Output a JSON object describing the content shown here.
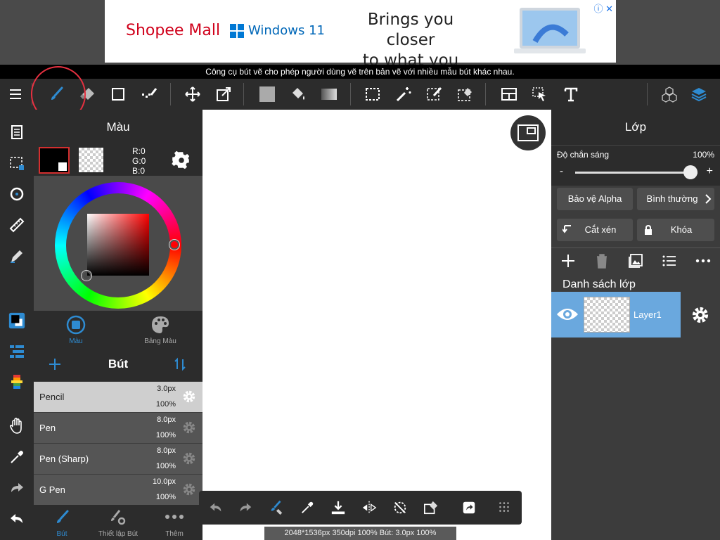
{
  "ad": {
    "brand": "Shopee Mall",
    "product": "Windows 11",
    "tagline_1": "Brings you closer",
    "tagline_2": "to what you love.",
    "close_glyph": "ⓘ ✕"
  },
  "tooltip": "Công cụ bút vẽ cho phép người dùng vẽ trên bản vẽ với nhiều mẫu bút khác nhau.",
  "colors": {
    "accent": "#2e8bd1",
    "selected_layer": "#6aa8de",
    "highlight": "#e53040",
    "panel_dark": "#2c2c2c",
    "panel_mid": "#3c3c3c"
  },
  "toolbar": {
    "menu_icon": "hamburger-icon",
    "tools": [
      "brush-icon",
      "eraser-icon",
      "shape-rect-icon",
      "dot-pen-icon",
      "move-icon",
      "transform-icon",
      "fill-color-icon",
      "bucket-icon",
      "gradient-icon",
      "select-rect-icon",
      "magic-wand-icon",
      "select-pen-icon",
      "select-eraser-icon",
      "panel-layout-icon",
      "select-pointer-icon",
      "text-icon",
      "3d-cubes-icon",
      "layers-icon"
    ]
  },
  "color_panel": {
    "title": "Màu",
    "rgb_r": "R:0",
    "rgb_g": "G:0",
    "rgb_b": "B:0",
    "tab_color": "Màu",
    "tab_palette": "Bảng Màu"
  },
  "brush_panel": {
    "title": "Bút",
    "brushes": [
      {
        "name": "Pencil",
        "size": "3.0px",
        "opacity": "100%"
      },
      {
        "name": "Pen",
        "size": "8.0px",
        "opacity": "100%"
      },
      {
        "name": "Pen (Sharp)",
        "size": "8.0px",
        "opacity": "100%"
      },
      {
        "name": "G Pen",
        "size": "10.0px",
        "opacity": "100%"
      }
    ],
    "tab_brush": "Bút",
    "tab_settings": "Thiết lập Bút",
    "tab_more": "Thêm"
  },
  "status": "2048*1536px 350dpi 100% Bút: 3.0px 100%",
  "layer_panel": {
    "title": "Lớp",
    "opacity_label": "Độ chắn sáng",
    "opacity_value": "100%",
    "opacity_fraction": 1.0,
    "minus": "-",
    "plus": "+",
    "alpha_protect": "Bảo vệ Alpha",
    "blend_mode": "Bình thường",
    "clipping": "Cắt xén",
    "lock": "Khóa",
    "list_title": "Danh sách lớp",
    "layer_name": "Layer1"
  }
}
